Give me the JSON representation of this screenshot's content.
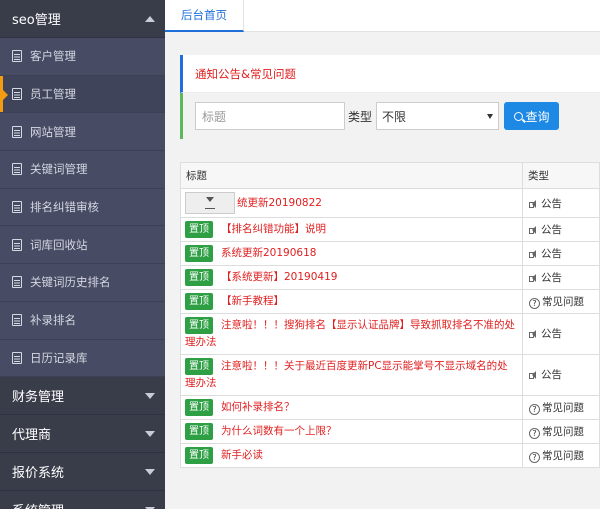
{
  "sidebar": {
    "group_seo": "seo管理",
    "items": [
      {
        "label": "客户管理"
      },
      {
        "label": "员工管理"
      },
      {
        "label": "网站管理"
      },
      {
        "label": "关键词管理"
      },
      {
        "label": "排名纠错审核"
      },
      {
        "label": "词库回收站"
      },
      {
        "label": "关键词历史排名"
      },
      {
        "label": "补录排名"
      },
      {
        "label": "日历记录库"
      }
    ],
    "groups": [
      {
        "label": "财务管理"
      },
      {
        "label": "代理商"
      },
      {
        "label": "报价系统"
      },
      {
        "label": "系统管理"
      }
    ]
  },
  "tabs": {
    "home": "后台首页"
  },
  "notice": {
    "title": "通知公告&常见问题"
  },
  "search": {
    "placeholder": "标题",
    "type_label": "类型",
    "type_selected": "不限",
    "button_label": "查询"
  },
  "table": {
    "headers": {
      "title": "标题",
      "type": "类型"
    },
    "pin_label": "置顶",
    "rows": [
      {
        "title": "统更新20190822",
        "type": "公告"
      },
      {
        "title": "【排名纠错功能】说明",
        "type": "公告"
      },
      {
        "title": "系统更新20190618",
        "type": "公告"
      },
      {
        "title": "【系统更新】20190419",
        "type": "公告"
      },
      {
        "title": "【新手教程】",
        "type": "常见问题"
      },
      {
        "title": "注意啦！！！搜狗排名【显示认证品牌】导致抓取排名不准的处理办法",
        "type": "公告"
      },
      {
        "title": "注意啦！！！关于最近百度更新PC显示能掌号不显示域名的处理办法",
        "type": "公告"
      },
      {
        "title": "如何补录排名？",
        "type": "常见问题"
      },
      {
        "title": "为什么词数有一个上限？",
        "type": "常见问题"
      },
      {
        "title": "新手必读",
        "type": "常见问题"
      }
    ]
  }
}
